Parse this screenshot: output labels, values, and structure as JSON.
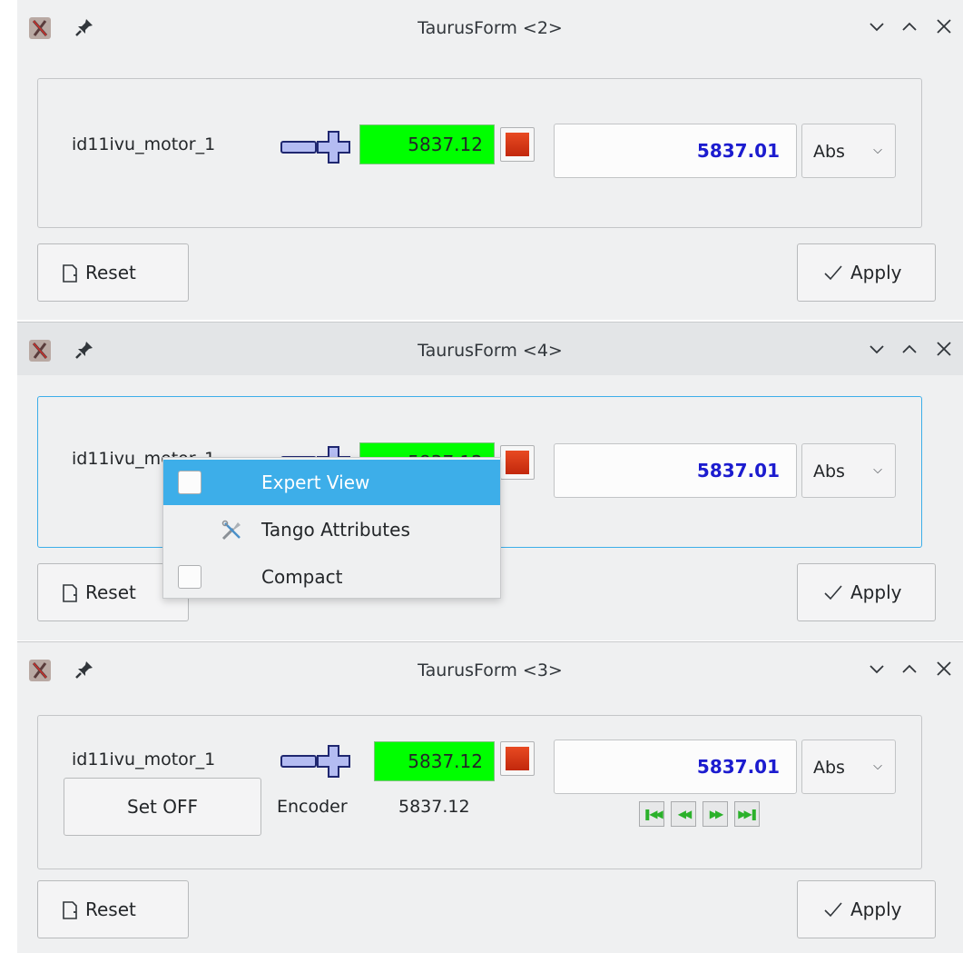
{
  "windows": [
    {
      "title": "TaurusForm <2>",
      "motor_label": "id11ivu_motor_1",
      "readout": "5837.12",
      "write_value": "5837.01",
      "combo_value": "Abs",
      "reset_label": "Reset",
      "apply_label": "Apply"
    },
    {
      "title": "TaurusForm <4>",
      "motor_label": "id11ivu_motor_1",
      "readout": "5837.12",
      "write_value": "5837.01",
      "combo_value": "Abs",
      "reset_label": "Reset",
      "apply_label": "Apply"
    },
    {
      "title": "TaurusForm <3>",
      "motor_label": "id11ivu_motor_1",
      "readout": "5837.12",
      "write_value": "5837.01",
      "combo_value": "Abs",
      "reset_label": "Reset",
      "apply_label": "Apply",
      "set_off_label": "Set OFF",
      "encoder_label": "Encoder",
      "encoder_value": "5837.12"
    }
  ],
  "context_menu": {
    "items": [
      {
        "label": "Expert View",
        "type": "checkbox",
        "checked": false,
        "highlighted": true
      },
      {
        "label": "Tango Attributes",
        "type": "action",
        "icon": "tools-icon"
      },
      {
        "label": "Compact",
        "type": "checkbox",
        "checked": false
      }
    ]
  },
  "titlebar_buttons": [
    "minimize-icon",
    "maximize-icon",
    "close-icon"
  ],
  "colors": {
    "readout_background": "#00ff00",
    "state_led": "#d9360f",
    "write_value_text": "#1c1ccf",
    "highlight": "#3daee9",
    "window_background": "#eff0f1",
    "nav_arrows": "#2bb12b"
  }
}
